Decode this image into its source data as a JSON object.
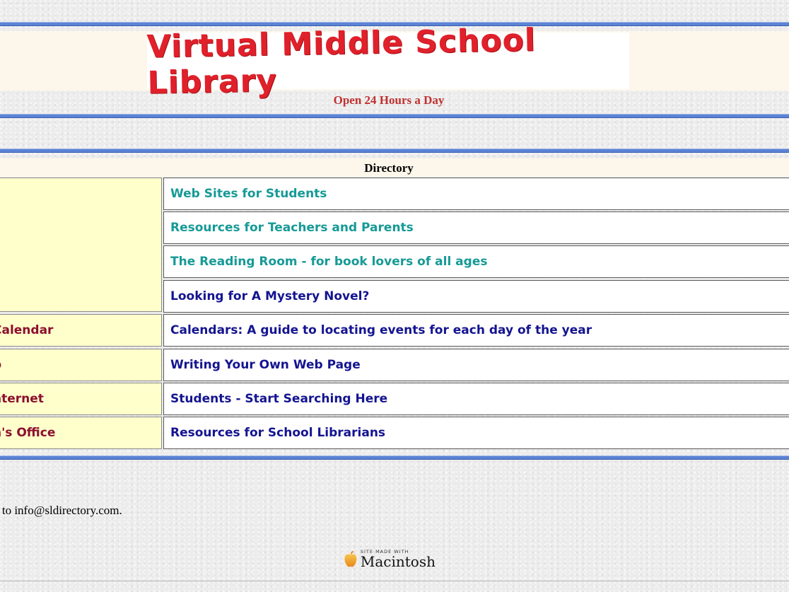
{
  "header": {
    "title": "Virtual Middle School Library",
    "subtitle": "Open 24 Hours a Day"
  },
  "directory": {
    "title": "Directory",
    "left_labels": [
      "Calendar",
      "b",
      "nternet",
      "n's Office"
    ],
    "links": [
      {
        "label": "Web Sites for Students",
        "color": "#169a96"
      },
      {
        "label": "Resources for Teachers and Parents",
        "color": "#169a96"
      },
      {
        "label": "The Reading Room - for book lovers of all ages",
        "color": "#169a96"
      },
      {
        "label": "Looking for A Mystery Novel?",
        "color": "#141491"
      },
      {
        "label": "Calendars: A guide to locating events for each day of the year",
        "color": "#141491"
      },
      {
        "label": "Writing Your Own Web Page",
        "color": "#141491"
      },
      {
        "label": "Students - Start Searching Here",
        "color": "#141491"
      },
      {
        "label": "Resources for School Librarians",
        "color": "#141491"
      }
    ]
  },
  "footer": {
    "contact": "s to info@sldirectory.com.",
    "badge_small": "SITE MADE WITH",
    "badge_big": "Macintosh"
  },
  "colors": {
    "rule": "#5b83d4",
    "title_red": "#e0202a",
    "left_label": "#8b0f2e",
    "teal_link": "#169a96",
    "navy_link": "#141491"
  }
}
